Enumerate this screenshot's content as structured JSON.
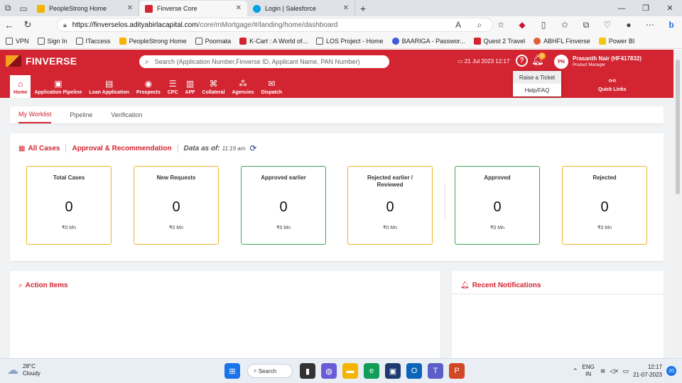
{
  "browser": {
    "tabs": [
      {
        "title": "PeopleStrong Home",
        "color": "#f5b400"
      },
      {
        "title": "Finverse Core",
        "color": "#d22431"
      },
      {
        "title": "Login | Salesforce",
        "color": "#00a1e0"
      }
    ],
    "url_host": "https://finverselos.adityabirlacapital.com",
    "url_path": "/core/mMortgage/#/landing/home/dashboard",
    "bookmarks": [
      "VPN",
      "Sign In",
      "ITaccess",
      "PeopleStrong Home",
      "Poornata",
      "K-Cart : A World of...",
      "LOS Project - Home",
      "BAARIGA - Passwor...",
      "Quest 2 Travel",
      "ABHFL Finverse",
      "Power BI"
    ]
  },
  "header": {
    "brand": "FINVERSE",
    "search_placeholder": "Search (Application Number,Finverse ID, Applicant Name, PAN Number)",
    "date": "21 Jul 2023 12:17",
    "notification_count": "0",
    "avatar_initials": "PN",
    "user_name": "Prasanth Nair (HF417832)",
    "user_role": "Product Manager",
    "menu": [
      {
        "label": "Home",
        "icon": "home-icon"
      },
      {
        "label": "Application Pipeline",
        "icon": "pipeline-icon"
      },
      {
        "label": "Loan Application",
        "icon": "document-icon"
      },
      {
        "label": "Prospects",
        "icon": "prospects-icon"
      },
      {
        "label": "CPC",
        "icon": "cpc-icon"
      },
      {
        "label": "APF",
        "icon": "apf-icon"
      },
      {
        "label": "Collateral",
        "icon": "collateral-icon"
      },
      {
        "label": "Agencies",
        "icon": "agencies-icon"
      },
      {
        "label": "Dispatch",
        "icon": "dispatch-icon"
      }
    ],
    "quick_links": "Quick Links",
    "help_menu": [
      "Raise a Ticket",
      "Help/FAQ"
    ]
  },
  "worklist_tabs": [
    "My Worklist",
    "Pipeline",
    "Verification"
  ],
  "dashboard": {
    "all_cases": "All Cases",
    "approval": "Approval & Recommendation",
    "data_as_of_label": "Data as of:",
    "data_as_of_time": "11:19 am",
    "cards": [
      {
        "label": "Total Cases",
        "value": "0",
        "amount": "₹0 Mn",
        "color": "#f0b429"
      },
      {
        "label": "New Requests",
        "value": "0",
        "amount": "₹0 Mn",
        "color": "#f0b429"
      },
      {
        "label": "Approved earlier",
        "value": "0",
        "amount": "₹0 Mn",
        "color": "#3aa655"
      },
      {
        "label": "Rejected earlier / Reviewed",
        "value": "0",
        "amount": "₹0 Mn",
        "color": "#f0b429"
      },
      {
        "label": "Approved",
        "value": "0",
        "amount": "₹0 Mn",
        "color": "#3aa655"
      },
      {
        "label": "Rejected",
        "value": "0",
        "amount": "₹0 Mn",
        "color": "#f0b429"
      }
    ]
  },
  "action_items_title": "Action Items",
  "notifications_title": "Recent Notifications",
  "taskbar": {
    "temp": "28°C",
    "weather": "Cloudy",
    "search": "Search",
    "lang1": "ENG",
    "lang2": "IN",
    "time": "12:17",
    "date": "21-07-2023",
    "notif_count": "20"
  }
}
